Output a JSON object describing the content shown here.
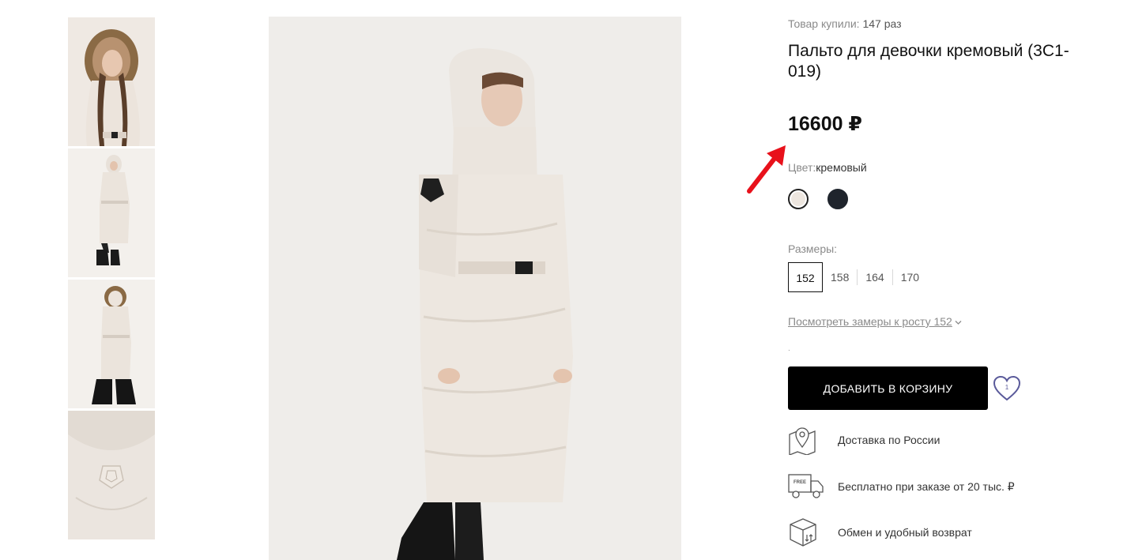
{
  "gallery": {
    "thumbnails": [
      "thumbnail-front-fur-hood",
      "thumbnail-full-front",
      "thumbnail-full-back",
      "thumbnail-hood-logo-detail"
    ],
    "main_image": "coat-main-photo"
  },
  "product": {
    "purchased_label": "Товар купили:",
    "purchased_count": "147 раз",
    "title": "Пальто для девочки кремовый (3С1-019)",
    "price": "16600 ₽",
    "color_label": "Цвет:",
    "color_value": "кремовый",
    "swatches": [
      {
        "name": "cream",
        "color": "#ede6df",
        "selected": true
      },
      {
        "name": "navy",
        "color": "#1f242c",
        "selected": false
      }
    ],
    "sizes_label": "Размеры:",
    "sizes": [
      "152",
      "158",
      "164",
      "170"
    ],
    "selected_size": "152",
    "measure_link": "Посмотреть замеры к росту 152",
    "dot": ".",
    "add_to_cart": "ДОБАВИТЬ В КОРЗИНУ",
    "favorite_count": "1"
  },
  "features": [
    {
      "icon": "map-pin-icon",
      "text": "Доставка по России"
    },
    {
      "icon": "delivery-truck-icon",
      "text": "Бесплатно при заказе от 20 тыс. ₽"
    },
    {
      "icon": "exchange-box-icon",
      "text": "Обмен и удобный возврат"
    }
  ],
  "colors": {
    "accent_button": "#000000",
    "annotation_arrow": "#e8111b",
    "heart_outline": "#5a5a9a"
  },
  "annotation": {
    "icon": "red-arrow-pointer"
  }
}
